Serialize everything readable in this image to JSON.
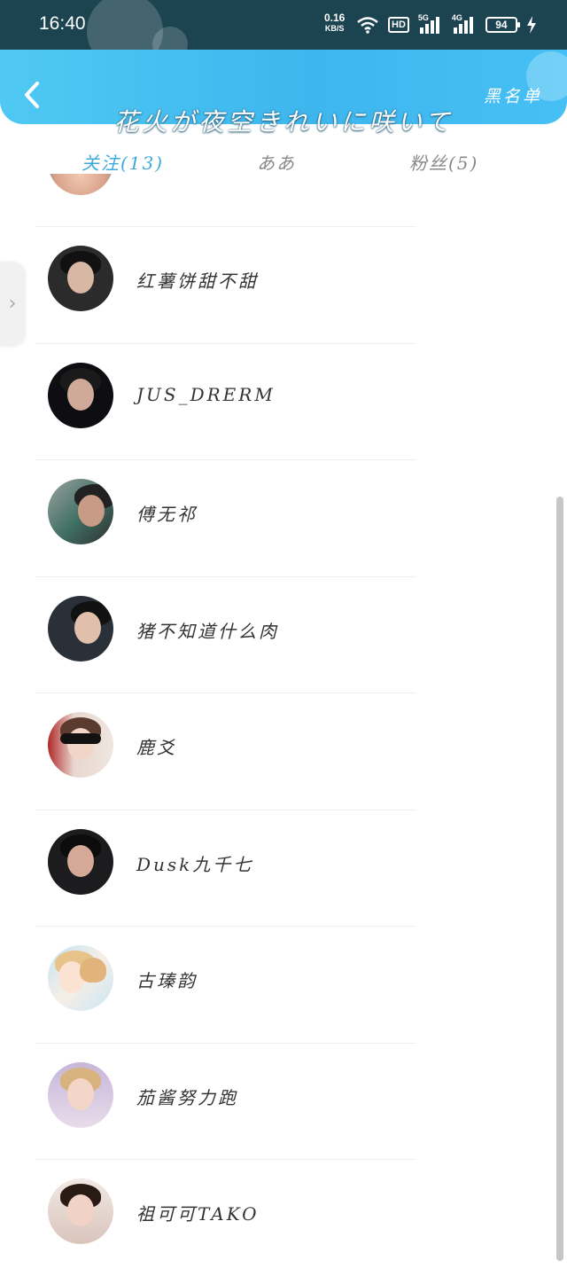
{
  "status_bar": {
    "time": "16:40",
    "speed_value": "0.16",
    "speed_unit": "KB/S",
    "hd_label": "HD",
    "net1": "5G",
    "net2": "4G",
    "battery": "94"
  },
  "header": {
    "title": "花火が夜空きれいに咲いて",
    "blacklist_label": "黑名单"
  },
  "tabs": {
    "follow": "关注(13)",
    "middle": "ああ",
    "fans": "粉丝(5)"
  },
  "colors": {
    "header_accent": "#3db6ee",
    "active_tab": "#3fa9df",
    "status_bar_bg": "#1b4350"
  },
  "contacts": [
    {
      "name": "红薯饼甜不甜"
    },
    {
      "name": "JUS_DRERM"
    },
    {
      "name": "傅无祁"
    },
    {
      "name": "猪不知道什么肉"
    },
    {
      "name": "鹿爻"
    },
    {
      "name": "Dusk九千七"
    },
    {
      "name": "古瑧韵"
    },
    {
      "name": "茄酱努力跑"
    },
    {
      "name": "祖可可TAKO"
    }
  ]
}
